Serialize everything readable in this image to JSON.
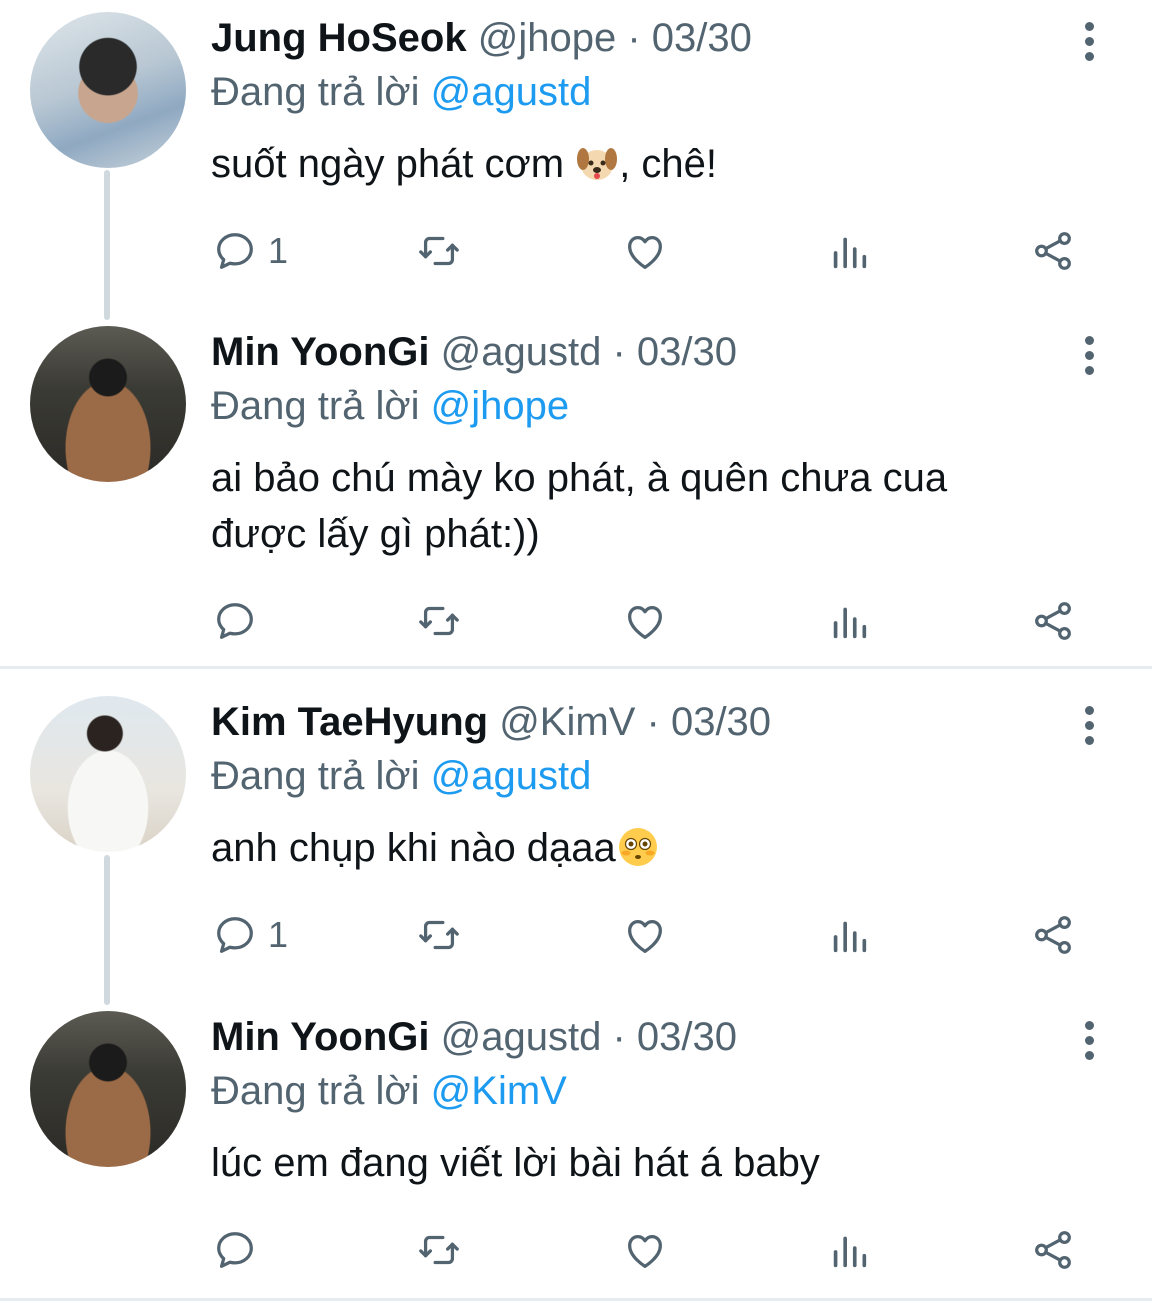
{
  "tweets": [
    {
      "name": "Jung HoSeok",
      "handle": "@jhope",
      "separator": "·",
      "date": "03/30",
      "reply_prefix": "Đang trả lời",
      "reply_to": "@agustd",
      "text_before_emoji": "suốt ngày phát cơm ",
      "emoji": "dog-face-emoji",
      "text_after_emoji": ", chê!",
      "reply_count": "1"
    },
    {
      "name": "Min YoonGi",
      "handle": "@agustd",
      "separator": "·",
      "date": "03/30",
      "reply_prefix": "Đang trả lời",
      "reply_to": "@jhope",
      "text_line1": "ai bảo chú mày ko phát, à quên chưa cua",
      "text_line2": "được lấy gì phát:))",
      "reply_count": ""
    },
    {
      "name": "Kim TaeHyung",
      "handle": "@KimV",
      "separator": "·",
      "date": "03/30",
      "reply_prefix": "Đang trả lời",
      "reply_to": "@agustd",
      "text_before_emoji": "anh chụp khi nào dạaa",
      "emoji": "flushed-face-emoji",
      "reply_count": "1"
    },
    {
      "name": "Min YoonGi",
      "handle": "@agustd",
      "separator": "·",
      "date": "03/30",
      "reply_prefix": "Đang trả lời",
      "reply_to": "@KimV",
      "text": "lúc em đang viết lời bài hát á baby",
      "reply_count": ""
    }
  ],
  "colors": {
    "text": "#0f1419",
    "secondary": "#536471",
    "mention": "#1d9bf0",
    "thread_line": "#cfd9de"
  },
  "icons": [
    "reply-icon",
    "retweet-icon",
    "like-icon",
    "views-icon",
    "share-icon",
    "more-icon"
  ]
}
